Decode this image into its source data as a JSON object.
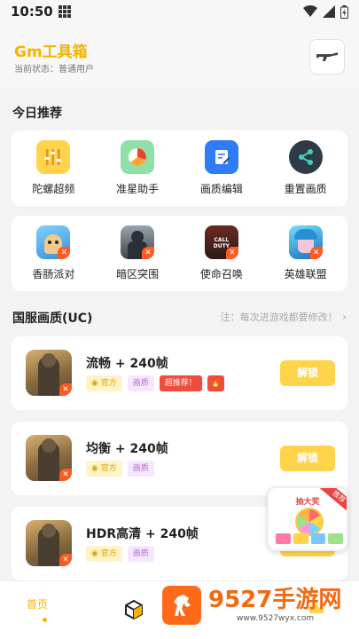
{
  "status_bar": {
    "time": "10:50"
  },
  "header": {
    "title": "Gm工具箱",
    "status_text": "当前状态：普通用户"
  },
  "today": {
    "title": "今日推荐",
    "tools": [
      {
        "label": "陀螺超频",
        "icon": "equalizer-icon"
      },
      {
        "label": "准星助手",
        "icon": "pie-chart-icon"
      },
      {
        "label": "画质编辑",
        "icon": "edit-document-icon"
      },
      {
        "label": "重置画质",
        "icon": "share-icon"
      }
    ],
    "games": [
      {
        "label": "香肠派对"
      },
      {
        "label": "暗区突围"
      },
      {
        "label": "使命召唤",
        "icon_text": "CALL DUTY"
      },
      {
        "label": "英雄联盟"
      }
    ]
  },
  "uc": {
    "title": "国服画质(UC)",
    "note": "注：每次进游戏都要修改！",
    "items": [
      {
        "name": "流畅 + 240帧",
        "tags": [
          "官方",
          "画质"
        ],
        "hot": "超推荐！",
        "button": "解锁"
      },
      {
        "name": "均衡 + 240帧",
        "tags": [
          "官方",
          "画质"
        ],
        "button": "解锁"
      },
      {
        "name": "HDR高清 + 240帧",
        "tags": [
          "官方",
          "画质"
        ],
        "button": "解锁"
      }
    ]
  },
  "popup": {
    "title": "抽大奖",
    "ribbon": "推荐"
  },
  "nav": {
    "home": "首页"
  },
  "watermark": {
    "text": "9527手游网",
    "url": "www.9527wyx.com"
  }
}
